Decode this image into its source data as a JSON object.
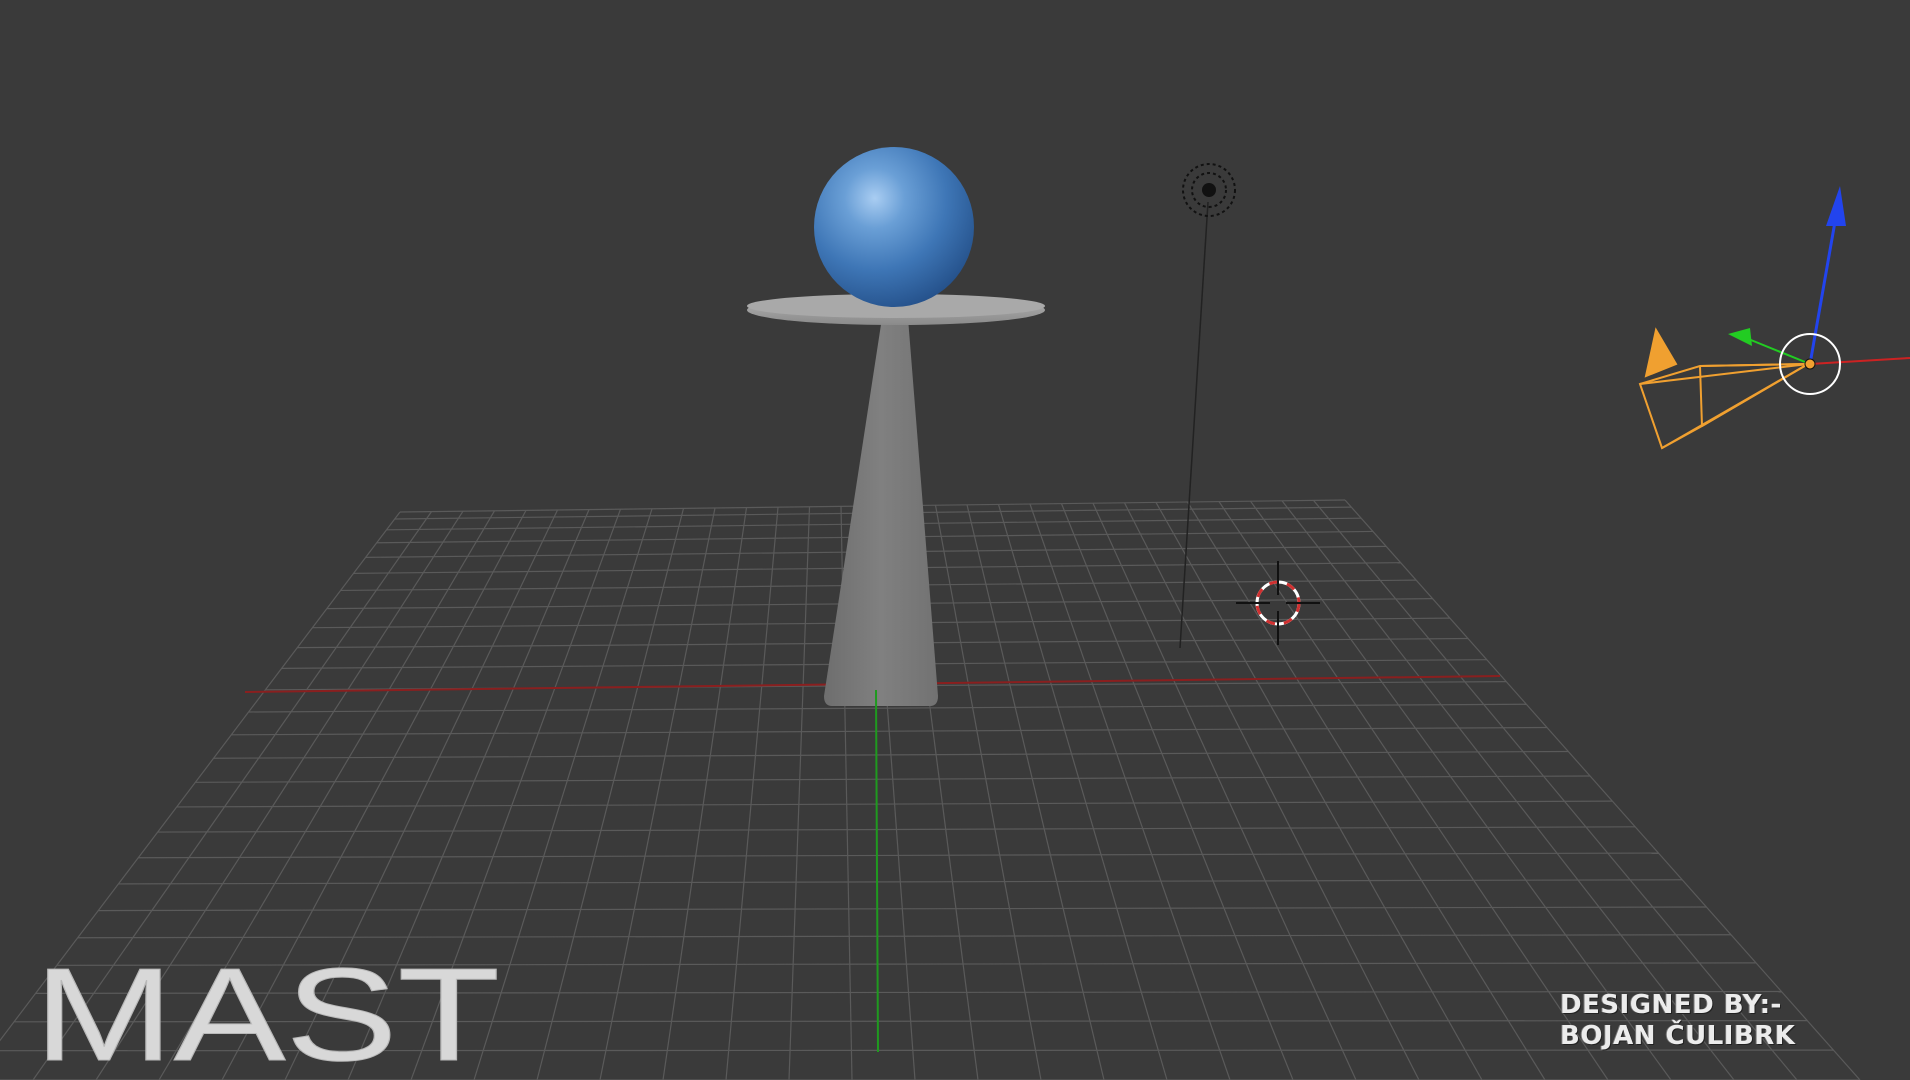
{
  "viewport": {
    "background": "#3a3a3a",
    "grid_color": "#5a5a5a",
    "x_axis_color": "#8a1f1f",
    "y_axis_color": "#1f9a1f"
  },
  "scene": {
    "objects": [
      {
        "name": "sphere",
        "color": "#4a84c4"
      },
      {
        "name": "disc",
        "color": "#a8a8a8"
      },
      {
        "name": "cone",
        "color": "#7b7b7b"
      },
      {
        "name": "lamp",
        "color": "#111111"
      },
      {
        "name": "camera",
        "color": "#f0a030"
      },
      {
        "name": "3d-cursor",
        "color": "#d03030"
      }
    ],
    "gizmo": {
      "x_color": "#cc2222",
      "y_color": "#22cc22",
      "z_color": "#2244ee"
    }
  },
  "overlay": {
    "logo_text": "MAST",
    "credit_line1": "DESIGNED BY:-",
    "credit_line2": "BOJAN ČULIBRK"
  }
}
